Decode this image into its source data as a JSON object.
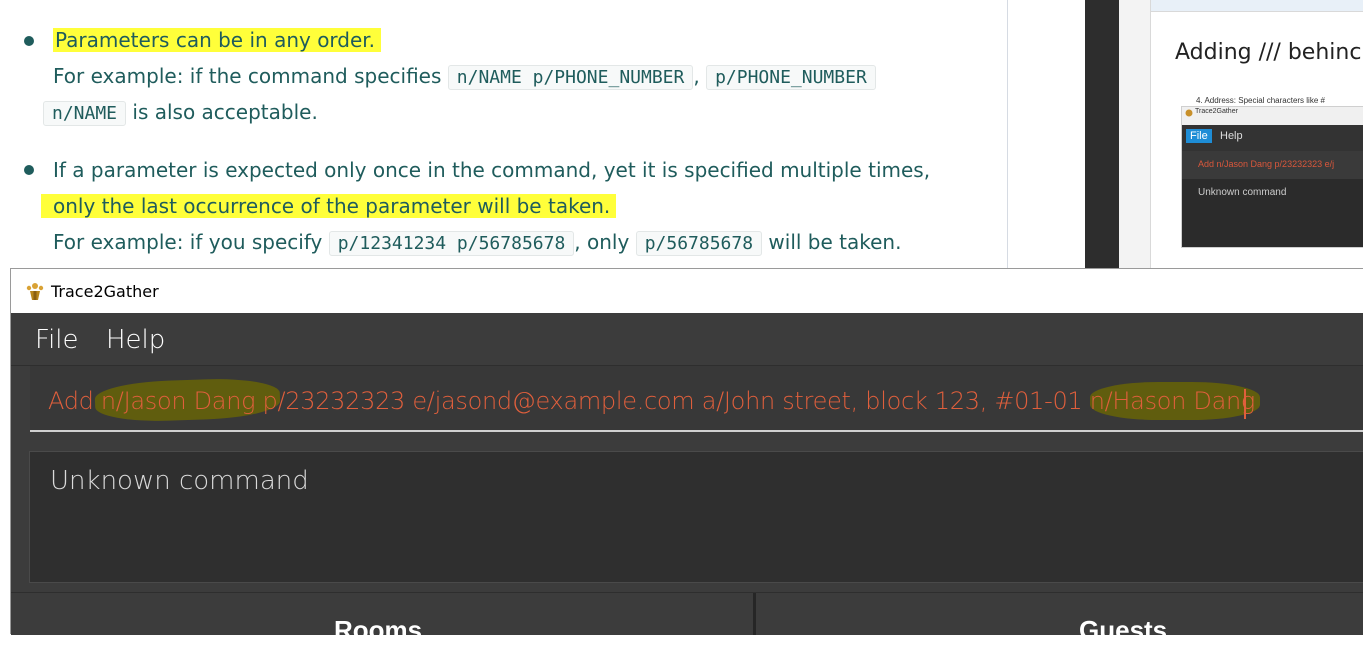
{
  "doc": {
    "bullet1_line1": "Parameters can be in any order.",
    "bullet1_line2_prefix": "For example: if the command specifies",
    "bullet1_code1": "n/NAME p/PHONE_NUMBER",
    "bullet1_comma": ",",
    "bullet1_code2a": "p/PHONE_NUMBER",
    "bullet1_code2b": "n/NAME",
    "bullet1_line3_suffix": "is also acceptable.",
    "bullet2_line1": "If a parameter is expected only once in the command, yet it is specified multiple times,",
    "bullet2_line2": "only the last occurrence of the parameter will be taken.",
    "bullet2_line3_prefix": "For example: if you specify",
    "bullet2_code1": "p/12341234 p/56785678",
    "bullet2_mid": ", only",
    "bullet2_code2": "p/56785678",
    "bullet2_suffix": "will be taken."
  },
  "right_doc": {
    "heading": "Adding /// behinc",
    "mini_caption": "4. Address: Special characters like  #",
    "mini_title": "Trace2Gather",
    "mini_menu_file": "File",
    "mini_menu_help": "Help",
    "mini_command": "Add n/Jason Dang p/23232323 e/j",
    "mini_result": "Unknown command"
  },
  "app": {
    "title": "Trace2Gather",
    "icon": "trace2gather-logo-icon",
    "menu": {
      "file": "File",
      "help": "Help"
    },
    "command_input_value": "Add n/Jason Dang p/23232323 e/jasond@example.com a/John street, block 123, #01-01 n/Hason Dang",
    "result_text": "Unknown command",
    "panels": {
      "rooms": "Rooms",
      "guests": "Guests"
    }
  },
  "colors": {
    "doc_text": "#1f5c5c",
    "highlight": "#ffff3a",
    "app_bg": "#3c3c3c",
    "command_text": "#e05f3c",
    "accent_blue": "#1e8dd6"
  }
}
